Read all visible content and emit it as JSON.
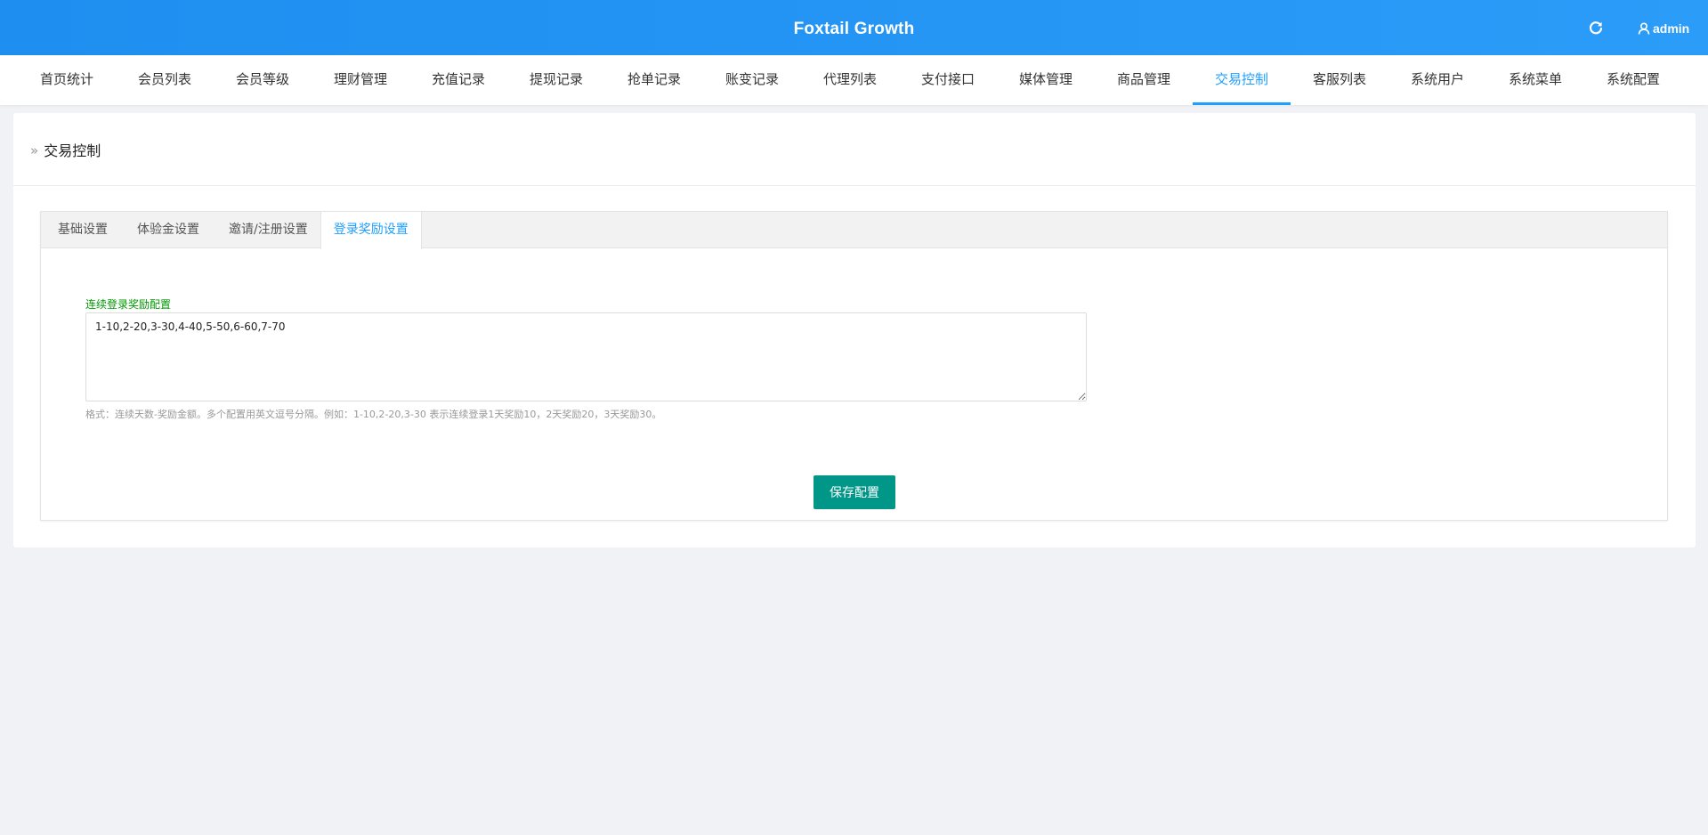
{
  "header": {
    "title": "Foxtail Growth",
    "refresh_icon": "refresh-icon",
    "user_icon": "user-icon",
    "username": "admin",
    "colors": {
      "from": "#1e8ef0",
      "to": "#2b9cf8"
    }
  },
  "nav": {
    "items": [
      {
        "label": "首页统计"
      },
      {
        "label": "会员列表"
      },
      {
        "label": "会员等级"
      },
      {
        "label": "理财管理"
      },
      {
        "label": "充值记录"
      },
      {
        "label": "提现记录"
      },
      {
        "label": "抢单记录"
      },
      {
        "label": "账变记录"
      },
      {
        "label": "代理列表"
      },
      {
        "label": "支付接口"
      },
      {
        "label": "媒体管理"
      },
      {
        "label": "商品管理"
      },
      {
        "label": "交易控制"
      },
      {
        "label": "客服列表"
      },
      {
        "label": "系统用户"
      },
      {
        "label": "系统菜单"
      },
      {
        "label": "系统配置"
      }
    ],
    "active_index": 12,
    "active_color": "#1e9fff"
  },
  "page": {
    "breadcrumb_icon": "»",
    "title": "交易控制"
  },
  "tabs": {
    "items": [
      {
        "label": "基础设置"
      },
      {
        "label": "体验金设置"
      },
      {
        "label": "邀请/注册设置"
      },
      {
        "label": "登录奖励设置"
      }
    ],
    "active_index": 3
  },
  "form": {
    "label": "连续登录奖励配置",
    "value": "1-10,2-20,3-30,4-40,5-50,6-60,7-70",
    "hint": "格式：连续天数-奖励金额。多个配置用英文逗号分隔。例如：1-10,2-20,3-30 表示连续登录1天奖励10，2天奖励20，3天奖励30。",
    "save_label": "保存配置",
    "save_color": "#009688"
  }
}
